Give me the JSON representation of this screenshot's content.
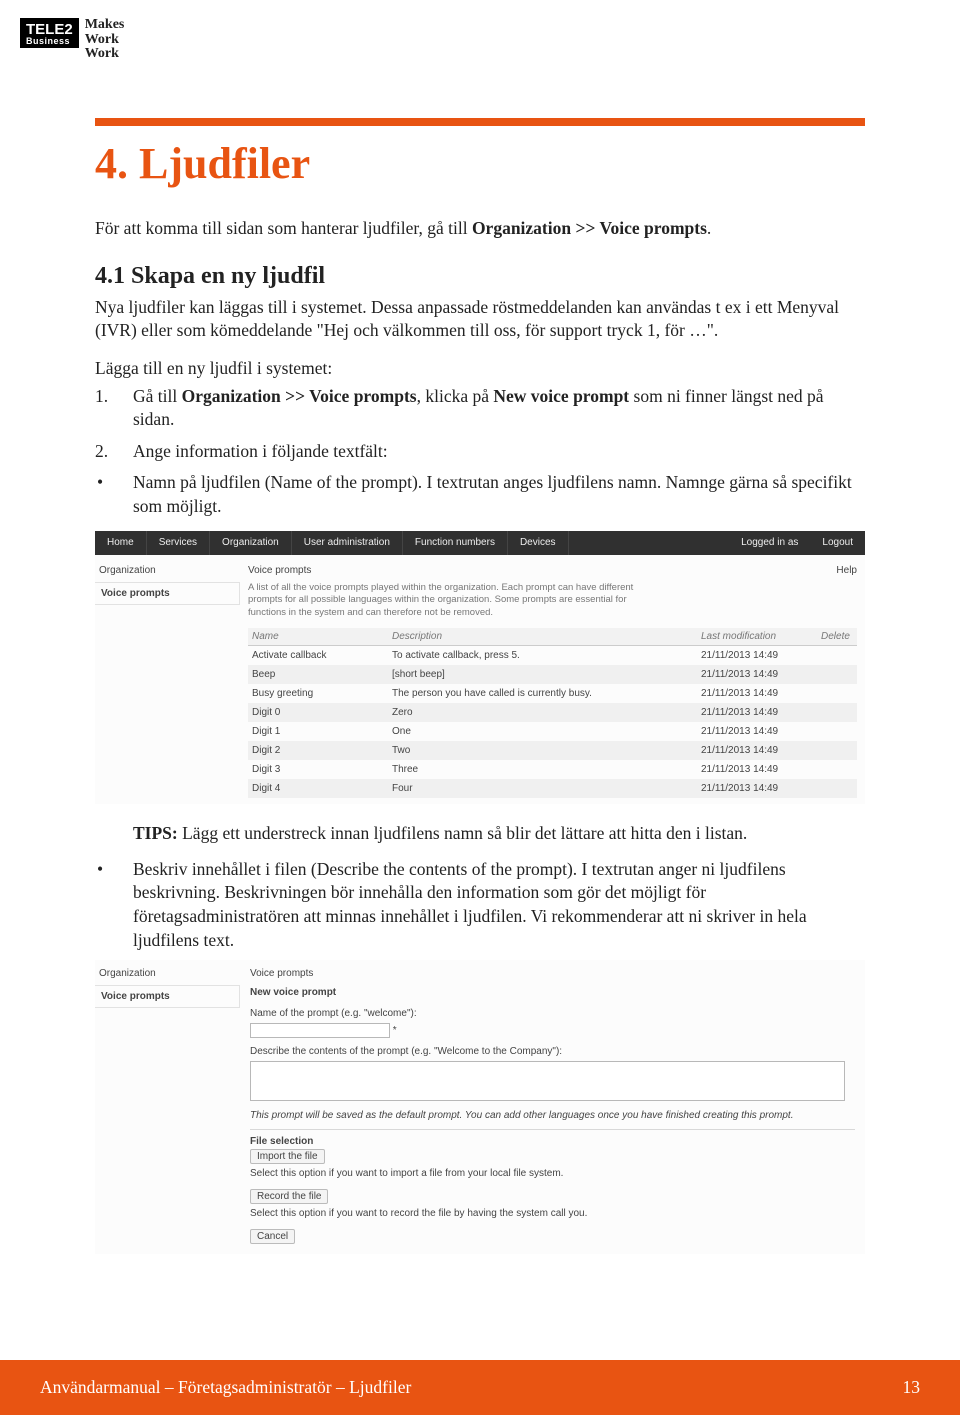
{
  "logo": {
    "brand_top": "TELE2",
    "brand_bottom": "Business",
    "slogan_l1": "Makes",
    "slogan_l2": "Work",
    "slogan_l3": "Work"
  },
  "h1": "4. Ljudfiler",
  "intro_pre": "För att komma till sidan som hanterar ljudfiler, gå till ",
  "intro_bold": "Organization >> Voice prompts",
  "intro_post": ".",
  "h2": "4.1 Skapa en ny ljudfil",
  "p1": "Nya ljudfiler kan läggas till i systemet. Dessa anpassade röstmeddelanden kan användas t ex i ett Menyval (IVR) eller som kömeddelande \"Hej och välkommen till oss, för support tryck 1, för …\".",
  "p2": "Lägga till en ny ljudfil i systemet:",
  "li1_num": "1.",
  "li1_a": "Gå till ",
  "li1_b": "Organization >> Voice prompts",
  "li1_c": ", klicka på ",
  "li1_d": "New voice prompt",
  "li1_e": " som ni finner längst ned på sidan.",
  "li2_num": "2.",
  "li2": "Ange information i följande textfält:",
  "li2b_bullet": "•",
  "li2b": "Namn på ljudfilen (Name of the prompt). I textrutan anges ljudfilens namn. Namnge gärna så specifikt som möjligt.",
  "shot1": {
    "menu": [
      "Home",
      "Services",
      "Organization",
      "User administration",
      "Function numbers",
      "Devices"
    ],
    "logged": "Logged in as",
    "logout": "Logout",
    "side_label": "Organization",
    "side_item": "Voice prompts",
    "title": "Voice prompts",
    "help": "Help",
    "desc": "A list of all the voice prompts played within the organization. Each prompt can have different prompts for all possible languages within the organization. Some prompts are essential for functions in the system and can therefore not be removed.",
    "th1": "Name",
    "th2": "Description",
    "th3": "Last modification",
    "th4": "Delete",
    "rows": [
      {
        "n": "Activate callback",
        "d": "To activate callback, press 5.",
        "t": "21/11/2013 14:49"
      },
      {
        "n": "Beep",
        "d": "[short beep]",
        "t": "21/11/2013 14:49"
      },
      {
        "n": "Busy greeting",
        "d": "The person you have called is currently busy.",
        "t": "21/11/2013 14:49"
      },
      {
        "n": "Digit 0",
        "d": "Zero",
        "t": "21/11/2013 14:49"
      },
      {
        "n": "Digit 1",
        "d": "One",
        "t": "21/11/2013 14:49"
      },
      {
        "n": "Digit 2",
        "d": "Two",
        "t": "21/11/2013 14:49"
      },
      {
        "n": "Digit 3",
        "d": "Three",
        "t": "21/11/2013 14:49"
      },
      {
        "n": "Digit 4",
        "d": "Four",
        "t": "21/11/2013 14:49"
      }
    ]
  },
  "tips_b": "TIPS:",
  "tips": " Lägg ett understreck innan ljudfilens namn så blir det lättare att hitta den i listan.",
  "li3_bullet": "•",
  "li3": "Beskriv innehållet i filen (Describe the contents of the prompt). I textrutan anger ni ljudfilens beskrivning. Beskrivningen bör innehålla den information som gör det möjligt för företagsadministratören att minnas innehållet i ljudfilen. Vi rekommenderar att ni skriver in hela ljudfilens text.",
  "shot2": {
    "side_label": "Organization",
    "side_item": "Voice prompts",
    "title": "Voice prompts",
    "sub": "New voice prompt",
    "label_name": "Name of the prompt (e.g. \"welcome\"):",
    "star": "*",
    "label_desc": "Describe the contents of the prompt (e.g. \"Welcome to the Company\"):",
    "note": "This prompt will be saved as the default prompt. You can add other languages once you have finished creating this prompt.",
    "section": "File selection",
    "btn_import": "Import the file",
    "hint_import": "Select this option if you want to import a file from your local file system.",
    "btn_record": "Record the file",
    "hint_record": "Select this option if you want to record the file by having the system call you.",
    "btn_cancel": "Cancel"
  },
  "footer": {
    "text": "Användarmanual – Företagsadministratör – Ljudfiler",
    "page": "13"
  }
}
